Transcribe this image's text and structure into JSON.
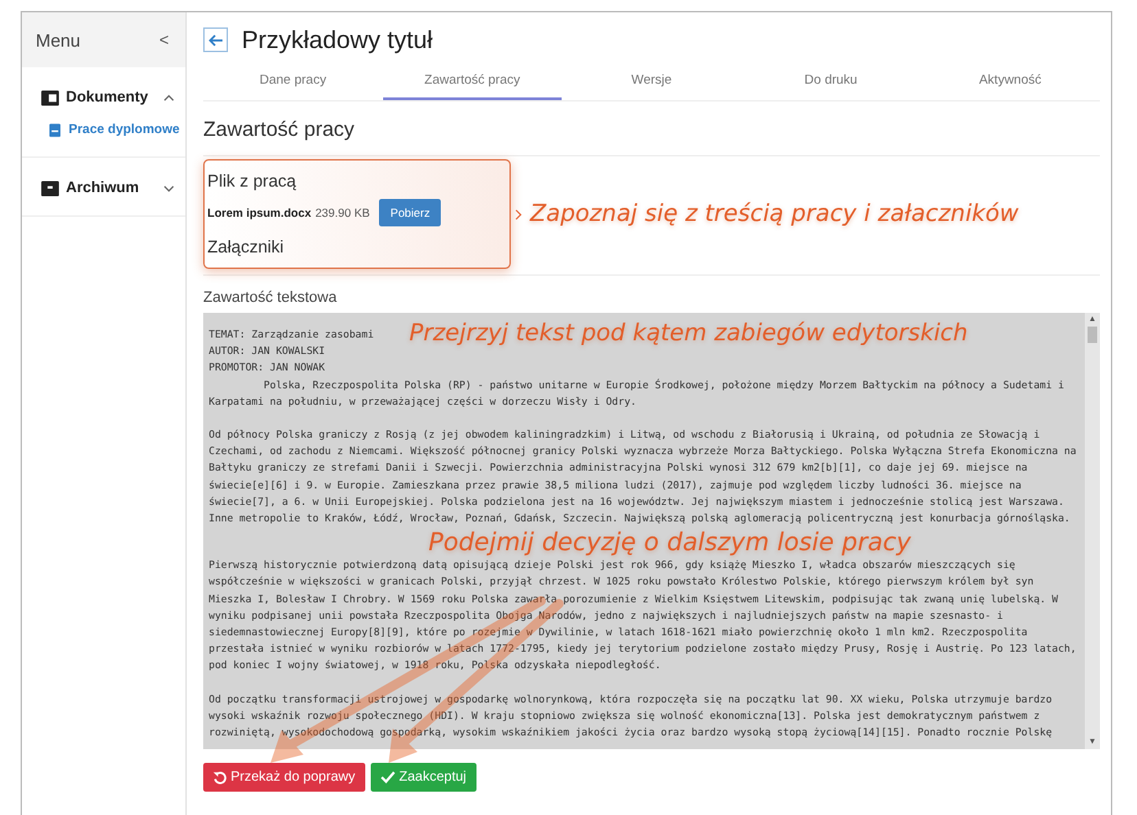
{
  "sidebar": {
    "title": "Menu",
    "collapse_glyph": "<",
    "items": [
      {
        "label": "Dokumenty",
        "expanded": true,
        "children": [
          {
            "label": "Prace dyplomowe",
            "selected": true
          }
        ]
      },
      {
        "label": "Archiwum",
        "expanded": false
      }
    ]
  },
  "page": {
    "title": "Przykładowy tytuł"
  },
  "tabs": [
    {
      "label": "Dane pracy",
      "selected": false
    },
    {
      "label": "Zawartość pracy",
      "selected": true
    },
    {
      "label": "Wersje",
      "selected": false
    },
    {
      "label": "Do druku",
      "selected": false
    },
    {
      "label": "Aktywność",
      "selected": false
    }
  ],
  "section_title": "Zawartość pracy",
  "file_card": {
    "title": "Plik z pracą",
    "file_name": "Lorem ipsum.docx",
    "file_size": "239.90 KB",
    "download_button": "Pobierz",
    "attachments_title": "Załączniki"
  },
  "text_content": {
    "title": "Zawartość tekstowa",
    "header_lines": [
      "TEMAT: Zarządzanie zasobami",
      "AUTOR: JAN KOWALSKI",
      "PROMOTOR: JAN NOWAK"
    ],
    "paragraphs": [
      "         Polska, Rzeczpospolita Polska (RP) - państwo unitarne w Europie Środkowej, położone między Morzem Bałtyckim na północy a Sudetami i Karpatami na południu, w przeważającej części w dorzeczu Wisły i Odry.",
      "Od północy Polska graniczy z Rosją (z jej obwodem kaliningradzkim) i Litwą, od wschodu z Białorusią i Ukrainą, od południa ze Słowacją i Czechami, od zachodu z Niemcami. Większość północnej granicy Polski wyznacza wybrzeże Morza Bałtyckiego. Polska Wyłączna Strefa Ekonomiczna na Bałtyku graniczy ze strefami Danii i Szwecji. Powierzchnia administracyjna Polski wynosi 312 679 km2[b][1], co daje jej 69. miejsce na świecie[e][6] i 9. w Europie. Zamieszkana przez prawie 38,5 miliona ludzi (2017), zajmuje pod względem liczby ludności 36. miejsce na świecie[7], a 6. w Unii Europejskiej. Polska podzielona jest na 16 województw. Jej największym miastem i jednocześnie stolicą jest Warszawa. Inne metropolie to Kraków, Łódź, Wrocław, Poznań, Gdańsk, Szczecin. Największą polską aglomeracją policentryczną jest konurbacja górnośląska.",
      "Pierwszą historycznie potwierdzoną datą opisującą dzieje Polski jest rok 966, gdy książę Mieszko I, władca obszarów mieszczących się współcześnie w większości w granicach Polski, przyjął chrzest. W 1025 roku powstało Królestwo Polskie, którego pierwszym królem był syn Mieszka I, Bolesław I Chrobry. W 1569 roku Polska zawarła porozumienie z Wielkim Księstwem Litewskim, podpisując tak zwaną unię lubelską. W wyniku podpisanej unii powstała Rzeczpospolita Obojga Narodów, jedno z największych i najludniejszych państw na mapie szesnasto- i siedemnastowiecznej Europy[8][9], które po rozejmie w Dywilinie, w latach 1618-1621 miało powierzchnię około 1 mln km2. Rzeczpospolita przestała istnieć w wyniku rozbiorów w latach 1772-1795, kiedy jej terytorium podzielone zostało między Prusy, Rosję i Austrię. Po 123 latach, pod koniec I wojny światowej, w 1918 roku, Polska odzyskała niepodległość.",
      "Od początku transformacji ustrojowej w gospodarkę wolnorynkową, która rozpoczęła się na początku lat 90. XX wieku, Polska utrzymuje bardzo wysoki wskaźnik rozwoju społecznego (HDI). W kraju stopniowo zwiększa się wolność ekonomiczna[13]. Polska jest demokratycznym państwem z rozwiniętą, wysokodochodową gospodarką, wysokim wskaźnikiem jakości życia oraz bardzo wysoką stopą życiową[14][15]. Ponadto rocznie Polskę"
    ]
  },
  "scrollbar": {
    "up_glyph": "▲",
    "down_glyph": "▼"
  },
  "actions": [
    {
      "kind": "reject",
      "label": "Przekaż do poprawy"
    },
    {
      "kind": "accept",
      "label": "Zaakceptuj"
    }
  ],
  "annotations": [
    "Zapoznaj się z treścią pracy i załaczników",
    "Przejrzyj tekst pod kątem zabiegów edytorskich",
    "Podejmij decyzję o dalszym losie pracy"
  ]
}
